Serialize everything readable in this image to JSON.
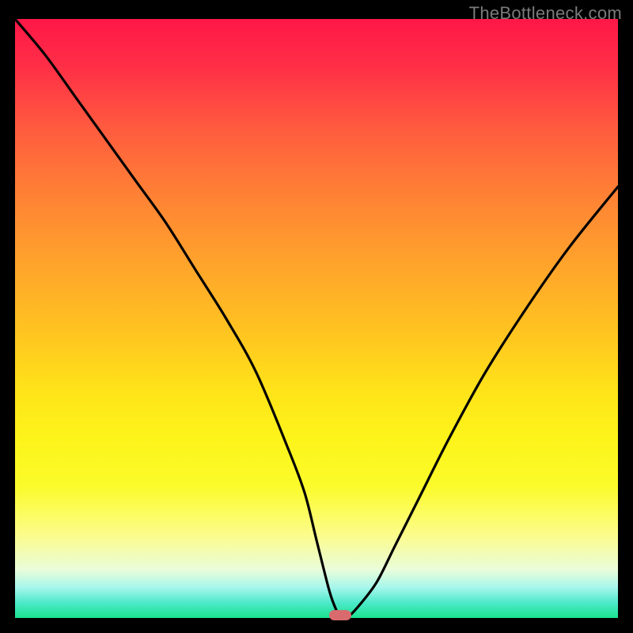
{
  "watermark": "TheBottleneck.com",
  "colors": {
    "background": "#000000",
    "curve": "#000000",
    "marker": "#d96a6d"
  },
  "chart_data": {
    "type": "line",
    "title": "",
    "xlabel": "",
    "ylabel": "",
    "xlim": [
      0,
      100
    ],
    "ylim": [
      0,
      100
    ],
    "grid": false,
    "legend": false,
    "background": "rainbow-vertical",
    "series": [
      {
        "name": "bottleneck-curve",
        "x": [
          0,
          5,
          10,
          15,
          20,
          25,
          30,
          35,
          40,
          45,
          48,
          50,
          52,
          53,
          54,
          55,
          57,
          60,
          63,
          67,
          72,
          78,
          85,
          92,
          100
        ],
        "y": [
          100,
          94,
          87,
          80,
          73,
          66,
          58,
          50,
          41,
          29,
          21,
          13,
          5,
          2,
          0,
          0,
          2,
          6,
          12,
          20,
          30,
          41,
          52,
          62,
          72
        ]
      }
    ],
    "marker": {
      "x": 54,
      "y": 0,
      "label": ""
    }
  }
}
